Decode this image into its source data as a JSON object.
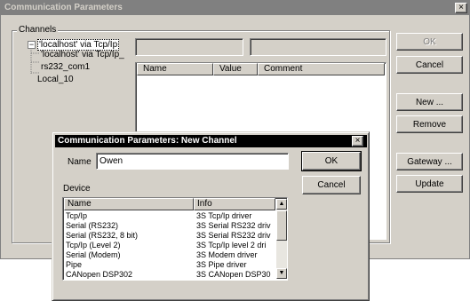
{
  "main_window": {
    "title": "Communication Parameters",
    "close": "×",
    "channels_group_label": "Channels",
    "tree": [
      {
        "label": "'localhost' via Tcp/Ip",
        "expander": "−"
      },
      {
        "label": "'localhost' via Tcp/Ip_"
      },
      {
        "label": "rs232_com1"
      },
      {
        "label": "Local_10"
      }
    ],
    "param_columns": [
      "Name",
      "Value",
      "Comment"
    ],
    "buttons": {
      "ok": "OK",
      "cancel": "Cancel",
      "new": "New ...",
      "remove": "Remove",
      "gateway": "Gateway ...",
      "update": "Update"
    }
  },
  "dialog": {
    "title": "Communication Parameters: New Channel",
    "close": "×",
    "name_label": "Name",
    "name_value": "Owen",
    "ok": "OK",
    "cancel": "Cancel",
    "device_label": "Device",
    "device_columns": [
      "Name",
      "Info"
    ],
    "devices": [
      {
        "name": "Tcp/Ip",
        "info": "3S Tcp/Ip driver"
      },
      {
        "name": "Serial (RS232)",
        "info": "3S Serial RS232 driv"
      },
      {
        "name": "Serial (RS232, 8 bit)",
        "info": "3S Serial RS232 driv"
      },
      {
        "name": "Tcp/Ip (Level 2)",
        "info": "3S Tcp/Ip level 2 dri"
      },
      {
        "name": "Serial (Modem)",
        "info": "3S Modem driver"
      },
      {
        "name": "Pipe",
        "info": "3S Pipe driver"
      },
      {
        "name": "CANopen DSP302",
        "info": "3S CANopen DSP30"
      }
    ],
    "scroll_up": "▲",
    "scroll_down": "▼"
  }
}
